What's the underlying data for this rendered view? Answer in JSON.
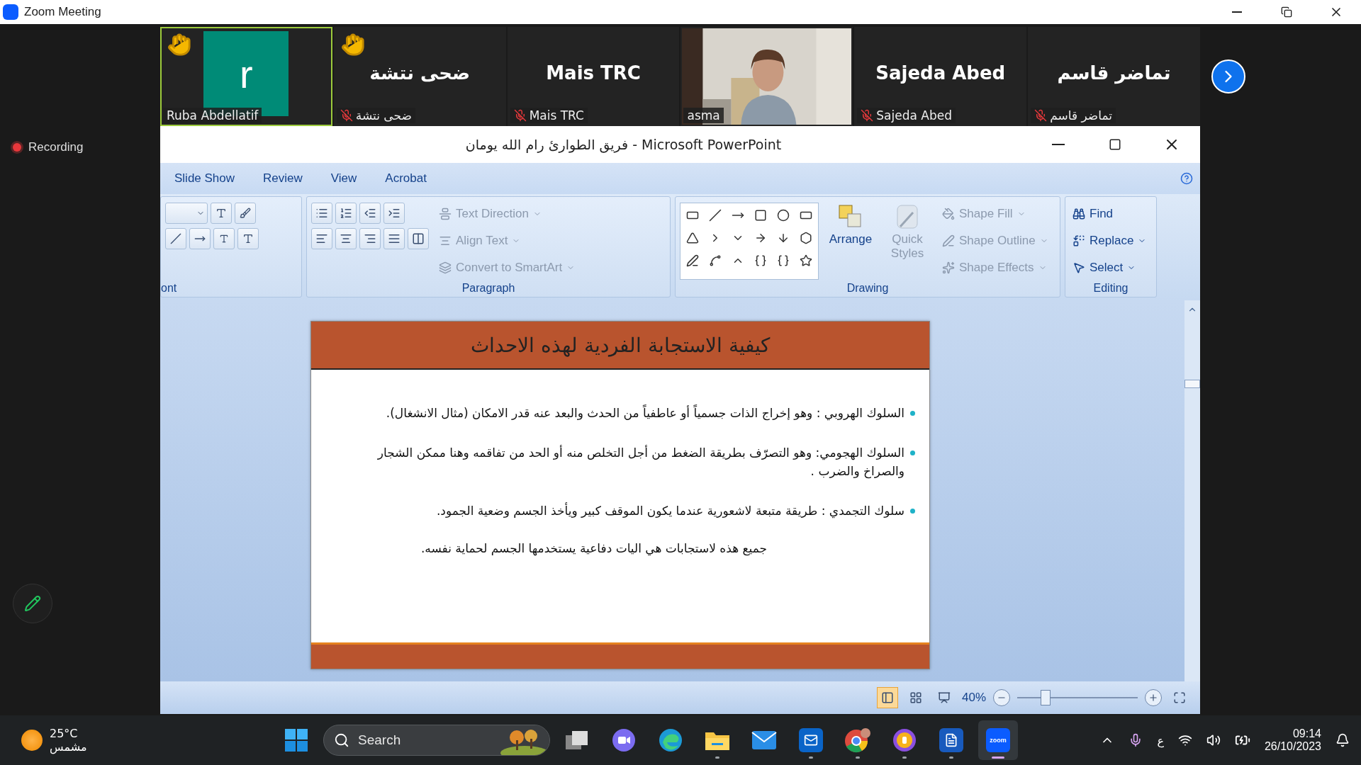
{
  "window": {
    "title": "Zoom Meeting"
  },
  "participants": [
    {
      "kind": "avatar",
      "initial": "r",
      "name": "Ruba Abdellatif",
      "hand_raised": true,
      "muted": false,
      "speaking": true
    },
    {
      "kind": "name",
      "display": "ضحى نتشة",
      "name": "ضحى نتشة",
      "hand_raised": true,
      "muted": true,
      "speaking": false
    },
    {
      "kind": "name",
      "display": "Mais TRC",
      "name": "Mais TRC",
      "hand_raised": false,
      "muted": true,
      "speaking": false
    },
    {
      "kind": "video",
      "name": "asma",
      "hand_raised": false,
      "muted": false,
      "speaking": false
    },
    {
      "kind": "name",
      "display": "Sajeda Abed",
      "name": "Sajeda Abed",
      "hand_raised": false,
      "muted": true,
      "speaking": false
    },
    {
      "kind": "name",
      "display": "تماضر قاسم",
      "name": "تماضر قاسم",
      "hand_raised": false,
      "muted": true,
      "speaking": false
    }
  ],
  "recording": {
    "label": "Recording"
  },
  "powerpoint": {
    "title": "فريق الطوارئ رام الله يومان - Microsoft PowerPoint",
    "tabs": [
      "Slide Show",
      "Review",
      "View",
      "Acrobat"
    ],
    "groups": [
      {
        "kind": "font",
        "label": "ont"
      },
      {
        "kind": "paragraph",
        "label": "Paragraph",
        "commands": [
          {
            "label": "Text Direction",
            "disabled": true
          },
          {
            "label": "Align Text",
            "disabled": true
          },
          {
            "label": "Convert to SmartArt",
            "disabled": true
          }
        ]
      },
      {
        "kind": "drawing",
        "label": "Drawing",
        "big": [
          {
            "label": "Arrange",
            "disabled": false
          },
          {
            "label": "Quick Styles",
            "disabled": true
          }
        ],
        "commands": [
          {
            "label": "Shape Fill",
            "disabled": true
          },
          {
            "label": "Shape Outline",
            "disabled": true
          },
          {
            "label": "Shape Effects",
            "disabled": true
          }
        ]
      },
      {
        "kind": "editing",
        "label": "Editing",
        "commands": [
          {
            "label": "Find",
            "disabled": false
          },
          {
            "label": "Replace",
            "disabled": false
          },
          {
            "label": "Select",
            "disabled": false
          }
        ]
      }
    ],
    "slide": {
      "title": "كيفية الاستجابة الفردية لهذه الاحداث",
      "bullets": [
        "السلوك الهروبي : وهو إخراج الذات جسمياً أو عاطفياً من الحدث والبعد عنه قدر الامكان (مثال الانشغال).",
        "السلوك الهجومي: وهو التصرّف بطريقة الضغط من أجل التخلص منه أو الحد من تفاقمه وهنا ممكن الشجار والصراخ والضرب .",
        "سلوك التجمدي :  طريقة متبعة لاشعورية عندما يكون الموقف كبير ويأخذ الجسم وضعية الجمود."
      ],
      "note": "جميع هذه لاستجابات هي اليات دفاعية يستخدمها الجسم لحماية نفسه."
    },
    "status": {
      "views": [
        {
          "kind": "normal",
          "selected": true
        },
        {
          "kind": "sorter",
          "selected": false
        },
        {
          "kind": "show",
          "selected": false
        }
      ],
      "zoom": "40%",
      "level": 0.23
    }
  },
  "taskbar": {
    "temperature": "25°C",
    "weather": "مشمس",
    "search": "Search",
    "apps": [
      {
        "kind": "start",
        "running": false,
        "active": false
      },
      {
        "kind": "taskview",
        "running": false,
        "active": false
      },
      {
        "kind": "teams",
        "running": false,
        "active": false
      },
      {
        "kind": "edge",
        "running": false,
        "active": false
      },
      {
        "kind": "explorer",
        "running": true,
        "active": false
      },
      {
        "kind": "mail",
        "running": false,
        "active": false
      },
      {
        "kind": "outlook",
        "running": true,
        "active": false
      },
      {
        "kind": "chrome",
        "running": true,
        "active": false
      },
      {
        "kind": "vpn",
        "running": true,
        "active": false
      },
      {
        "kind": "word",
        "running": true,
        "active": false
      },
      {
        "kind": "zoom",
        "label": "zoom",
        "running": true,
        "active": true
      }
    ],
    "language": "ع",
    "time": "09:14",
    "date": "26/10/2023"
  }
}
